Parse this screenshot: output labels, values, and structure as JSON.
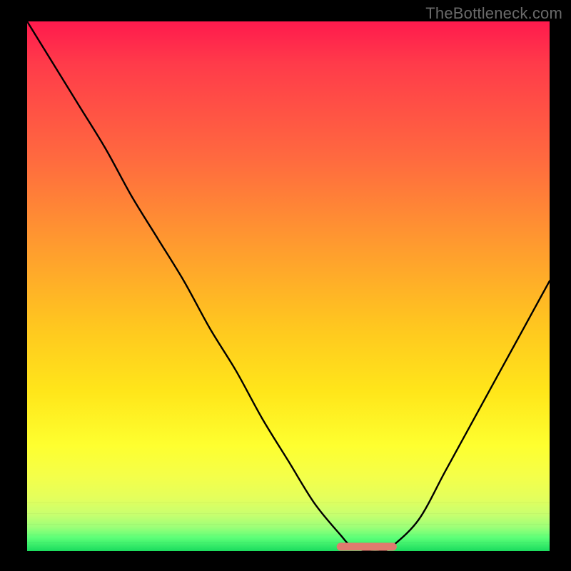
{
  "watermark": "TheBottleneck.com",
  "colors": {
    "line": "#000000",
    "marker": "#e07a6e",
    "background_top": "#ff1a4d",
    "background_bottom": "#1bdc5e",
    "frame": "#000000"
  },
  "chart_data": {
    "type": "line",
    "title": "",
    "xlabel": "",
    "ylabel": "",
    "xlim": [
      0,
      100
    ],
    "ylim": [
      0,
      100
    ],
    "grid": false,
    "legend": false,
    "x": [
      0,
      5,
      10,
      15,
      20,
      25,
      30,
      35,
      40,
      45,
      50,
      55,
      60,
      62,
      65,
      68,
      70,
      75,
      80,
      85,
      90,
      95,
      100
    ],
    "values": [
      100,
      92,
      84,
      76,
      67,
      59,
      51,
      42,
      34,
      25,
      17,
      9,
      3,
      1,
      0,
      0,
      1,
      6,
      15,
      24,
      33,
      42,
      51
    ],
    "valley_marker": {
      "x_start": 60,
      "x_end": 70,
      "y": 0
    },
    "note": "y-axis is inverted visually (0 at bottom = best/green, 100 at top = worst/red); values are approximate bottleneck percentages read off the gradient; no numeric labels are printed on the chart."
  }
}
